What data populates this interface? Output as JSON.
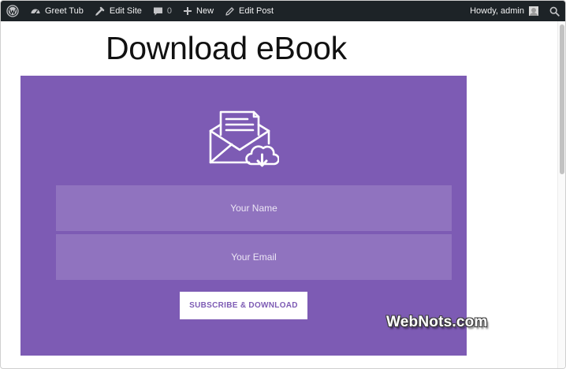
{
  "adminbar": {
    "wp_logo_icon": "wordpress-logo-icon",
    "site_name": "Greet Tub",
    "edit_site_label": "Edit Site",
    "comments_count": "0",
    "new_label": "New",
    "edit_post_label": "Edit Post",
    "howdy_label": "Howdy, admin",
    "search_icon": "search-icon",
    "bg_color": "#1d2327"
  },
  "page": {
    "title": "Download eBook"
  },
  "optin": {
    "bg_color": "#7d5bb4",
    "icon": "envelope-cloud-download-icon",
    "name_placeholder": "Your Name",
    "email_placeholder": "Your Email",
    "submit_label": "SUBSCRIBE & DOWNLOAD"
  },
  "watermark": {
    "text": "WebNots.com"
  }
}
